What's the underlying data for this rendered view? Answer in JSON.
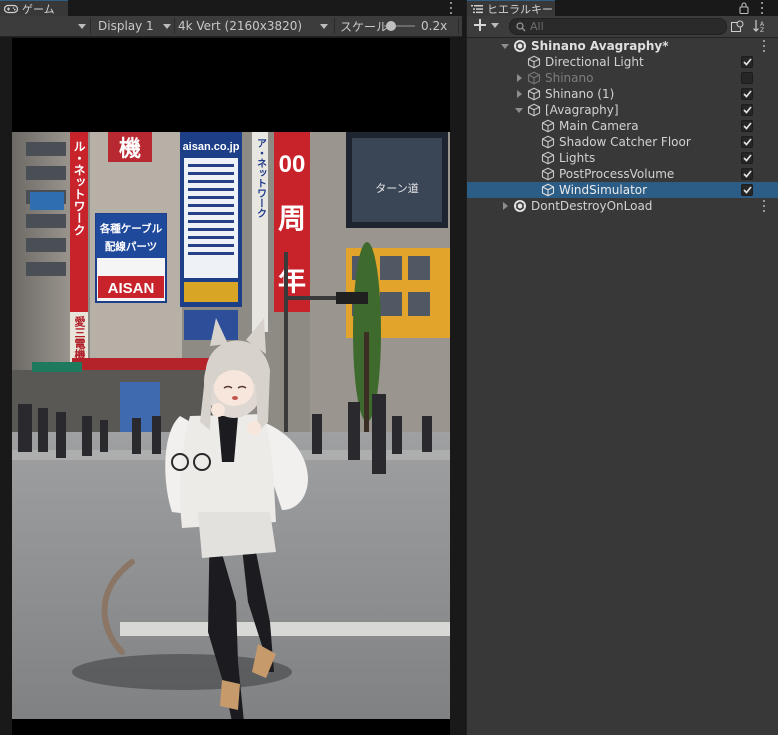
{
  "game": {
    "tab_label": "ゲーム",
    "display": "Display 1",
    "resolution": "4k Vert (2160x3820)",
    "scale_label": "スケール",
    "scale_value": "0.2x",
    "scale_fraction": 0.2
  },
  "scene_signs": {
    "sign_wire": "ル・ネットワーク",
    "sign_kanji_top": "機",
    "sign_aisan_url": "aisan.co.jp",
    "sign_cable_1": "各種ケーブル",
    "sign_cable_2": "配線パーツ",
    "sign_aisan": "AISAN",
    "sign_kanji_side": "愛三電機",
    "sign_00": "00",
    "sign_shu": "周",
    "sign_toshi": "年",
    "sign_network_v": "ア・ネットワーク",
    "sign_aisan_v": "AISAN",
    "billboard_text": "ターン道"
  },
  "hierarchy": {
    "tab_label": "ヒエラルキー",
    "search_placeholder": "All",
    "rows": [
      {
        "label": "Shinano Avagraphy*",
        "checked": false
      },
      {
        "label": "Directional Light",
        "checked": true
      },
      {
        "label": "Shinano",
        "checked": false
      },
      {
        "label": "Shinano (1)",
        "checked": true
      },
      {
        "label": "[Avagraphy]",
        "checked": true
      },
      {
        "label": "Main Camera",
        "checked": true
      },
      {
        "label": "Shadow Catcher Floor",
        "checked": true
      },
      {
        "label": "Lights",
        "checked": true
      },
      {
        "label": "PostProcessVolume",
        "checked": true
      },
      {
        "label": "WindSimulator",
        "checked": true
      },
      {
        "label": "DontDestroyOnLoad",
        "checked": false
      }
    ]
  },
  "icons": {
    "game": "gamepad-icon",
    "hierarchy": "list-icon",
    "add": "plus-icon",
    "search": "search-icon",
    "scene": "unity-scene-icon",
    "gameobject": "cube-icon",
    "lock": "lock-icon"
  },
  "colors": {
    "selection": "#2c5d87",
    "panel": "#383838",
    "toolbar": "#3c3c3c",
    "checkmark": "#e6e6e6"
  }
}
